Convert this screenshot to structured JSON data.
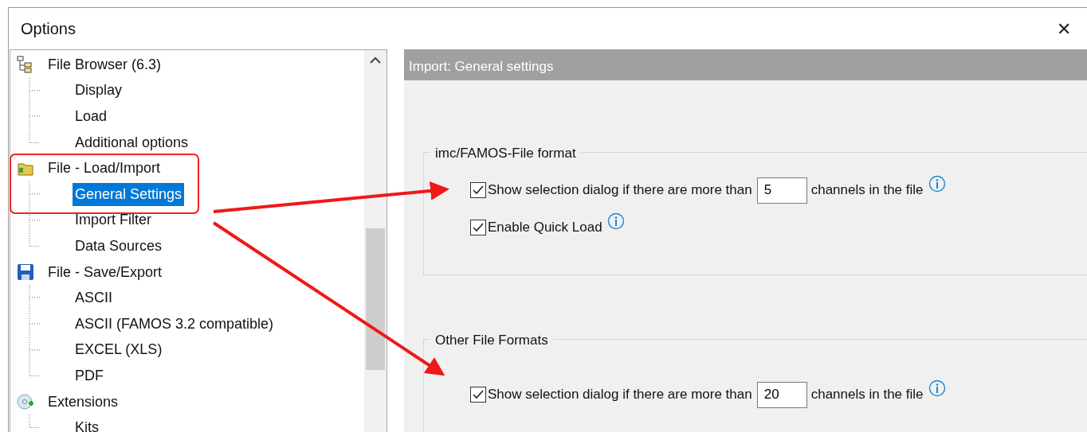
{
  "window": {
    "title": "Options",
    "close": "✕"
  },
  "tree": [
    {
      "label": "File Browser (6.3)",
      "kind": "tree",
      "selected": false,
      "children": [
        {
          "label": "Display",
          "selected": false
        },
        {
          "label": "Load",
          "selected": false
        },
        {
          "label": "Additional options",
          "selected": false
        }
      ]
    },
    {
      "label": "File - Load/Import",
      "kind": "folder",
      "selected": false,
      "children": [
        {
          "label": "General Settings",
          "selected": true
        },
        {
          "label": "Import Filter",
          "selected": false
        },
        {
          "label": "Data Sources",
          "selected": false
        }
      ]
    },
    {
      "label": "File - Save/Export",
      "kind": "disk",
      "selected": false,
      "children": [
        {
          "label": "ASCII",
          "selected": false
        },
        {
          "label": "ASCII (FAMOS 3.2 compatible)",
          "selected": false
        },
        {
          "label": "EXCEL (XLS)",
          "selected": false
        },
        {
          "label": "PDF",
          "selected": false
        }
      ]
    },
    {
      "label": "Extensions",
      "kind": "disc",
      "selected": false,
      "children": [
        {
          "label": "Kits",
          "selected": false
        }
      ]
    }
  ],
  "panel": {
    "header": "Import: General settings",
    "groups": [
      {
        "title": "imc/FAMOS-File format",
        "options": [
          {
            "kind": "count",
            "checked": true,
            "label": "Show selection dialog if there are more than",
            "value": "5",
            "suffix": "channels in the file"
          },
          {
            "kind": "plain",
            "checked": true,
            "label": "Enable Quick Load"
          }
        ]
      },
      {
        "title": "Other File Formats",
        "options": [
          {
            "kind": "count",
            "checked": true,
            "label": "Show selection dialog if there are more than",
            "value": "20",
            "suffix": "channels in the file"
          }
        ]
      }
    ]
  }
}
